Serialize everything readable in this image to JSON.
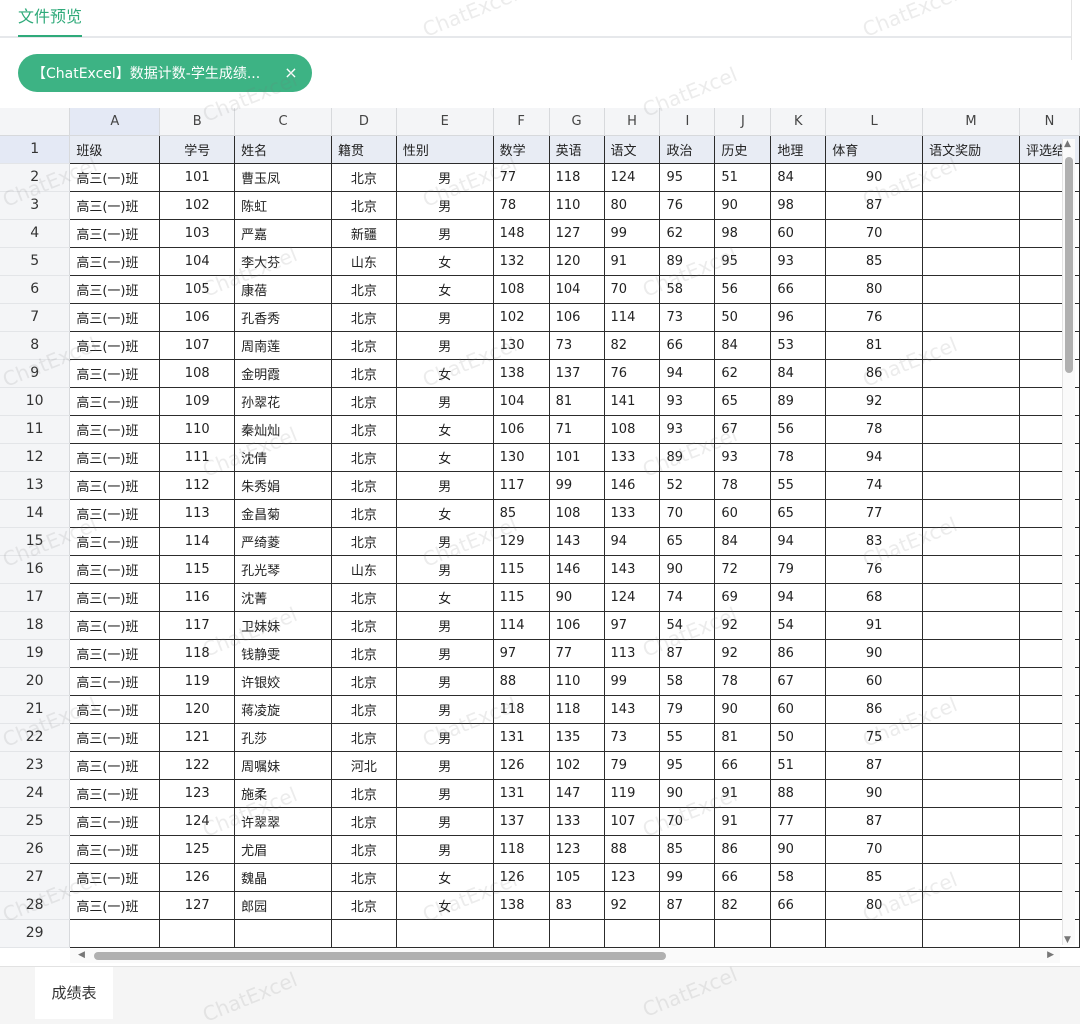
{
  "header": {
    "tab_label": "文件预览"
  },
  "file_chip": {
    "label": "【ChatExcel】数据计数-学生成绩...",
    "close": "×"
  },
  "sheet": {
    "columns": [
      "A",
      "B",
      "C",
      "D",
      "E",
      "F",
      "G",
      "H",
      "I",
      "J",
      "K",
      "L",
      "M",
      "N"
    ],
    "header_row": [
      "班级",
      "学号",
      "姓名",
      "籍贯",
      "性别",
      "数学",
      "英语",
      "语文",
      "政治",
      "历史",
      "地理",
      "体育",
      "语文奖励",
      "评选结"
    ],
    "rows": [
      [
        "高三(一)班",
        "101",
        "曹玉凤",
        "北京",
        "男",
        "77",
        "118",
        "124",
        "95",
        "51",
        "84",
        "90"
      ],
      [
        "高三(一)班",
        "102",
        "陈虹",
        "北京",
        "男",
        "78",
        "110",
        "80",
        "76",
        "90",
        "98",
        "87"
      ],
      [
        "高三(一)班",
        "103",
        "严嘉",
        "新疆",
        "男",
        "148",
        "127",
        "99",
        "62",
        "98",
        "60",
        "70"
      ],
      [
        "高三(一)班",
        "104",
        "李大芬",
        "山东",
        "女",
        "132",
        "120",
        "91",
        "89",
        "95",
        "93",
        "85"
      ],
      [
        "高三(一)班",
        "105",
        "康蓓",
        "北京",
        "女",
        "108",
        "104",
        "70",
        "58",
        "56",
        "66",
        "80"
      ],
      [
        "高三(一)班",
        "106",
        "孔香秀",
        "北京",
        "男",
        "102",
        "106",
        "114",
        "73",
        "50",
        "96",
        "76"
      ],
      [
        "高三(一)班",
        "107",
        "周南莲",
        "北京",
        "男",
        "130",
        "73",
        "82",
        "66",
        "84",
        "53",
        "81"
      ],
      [
        "高三(一)班",
        "108",
        "金明霞",
        "北京",
        "女",
        "138",
        "137",
        "76",
        "94",
        "62",
        "84",
        "86"
      ],
      [
        "高三(一)班",
        "109",
        "孙翠花",
        "北京",
        "男",
        "104",
        "81",
        "141",
        "93",
        "65",
        "89",
        "92"
      ],
      [
        "高三(一)班",
        "110",
        "秦灿灿",
        "北京",
        "女",
        "106",
        "71",
        "108",
        "93",
        "67",
        "56",
        "78"
      ],
      [
        "高三(一)班",
        "111",
        "沈倩",
        "北京",
        "女",
        "130",
        "101",
        "133",
        "89",
        "93",
        "78",
        "94"
      ],
      [
        "高三(一)班",
        "112",
        "朱秀娟",
        "北京",
        "男",
        "117",
        "99",
        "146",
        "52",
        "78",
        "55",
        "74"
      ],
      [
        "高三(一)班",
        "113",
        "金昌菊",
        "北京",
        "女",
        "85",
        "108",
        "133",
        "70",
        "60",
        "65",
        "77"
      ],
      [
        "高三(一)班",
        "114",
        "严绮菱",
        "北京",
        "男",
        "129",
        "143",
        "94",
        "65",
        "84",
        "94",
        "83"
      ],
      [
        "高三(一)班",
        "115",
        "孔光琴",
        "山东",
        "男",
        "115",
        "146",
        "143",
        "90",
        "72",
        "79",
        "76"
      ],
      [
        "高三(一)班",
        "116",
        "沈菁",
        "北京",
        "女",
        "115",
        "90",
        "124",
        "74",
        "69",
        "94",
        "68"
      ],
      [
        "高三(一)班",
        "117",
        "卫妹妹",
        "北京",
        "男",
        "114",
        "106",
        "97",
        "54",
        "92",
        "54",
        "91"
      ],
      [
        "高三(一)班",
        "118",
        "钱静雯",
        "北京",
        "男",
        "97",
        "77",
        "113",
        "87",
        "92",
        "86",
        "90"
      ],
      [
        "高三(一)班",
        "119",
        "许银姣",
        "北京",
        "男",
        "88",
        "110",
        "99",
        "58",
        "78",
        "67",
        "60"
      ],
      [
        "高三(一)班",
        "120",
        "蒋凌旋",
        "北京",
        "男",
        "118",
        "118",
        "143",
        "79",
        "90",
        "60",
        "86"
      ],
      [
        "高三(一)班",
        "121",
        "孔莎",
        "北京",
        "男",
        "131",
        "135",
        "73",
        "55",
        "81",
        "50",
        "75"
      ],
      [
        "高三(一)班",
        "122",
        "周嘱妹",
        "河北",
        "男",
        "126",
        "102",
        "79",
        "95",
        "66",
        "51",
        "87"
      ],
      [
        "高三(一)班",
        "123",
        "施柔",
        "北京",
        "男",
        "131",
        "147",
        "119",
        "90",
        "91",
        "88",
        "90"
      ],
      [
        "高三(一)班",
        "124",
        "许翠翠",
        "北京",
        "男",
        "137",
        "133",
        "107",
        "70",
        "91",
        "77",
        "87"
      ],
      [
        "高三(一)班",
        "125",
        "尤眉",
        "北京",
        "男",
        "118",
        "123",
        "88",
        "85",
        "86",
        "90",
        "70"
      ],
      [
        "高三(一)班",
        "126",
        "魏晶",
        "北京",
        "女",
        "126",
        "105",
        "123",
        "99",
        "66",
        "58",
        "85"
      ],
      [
        "高三(一)班",
        "127",
        "郎园",
        "北京",
        "女",
        "138",
        "83",
        "92",
        "87",
        "82",
        "66",
        "80"
      ]
    ],
    "partial_row_number": "29"
  },
  "sheet_tabs": [
    "成绩表"
  ],
  "watermark": "ChatExcel",
  "colors": {
    "accent": "#3db384",
    "header_fill": "#e8ecf4"
  }
}
